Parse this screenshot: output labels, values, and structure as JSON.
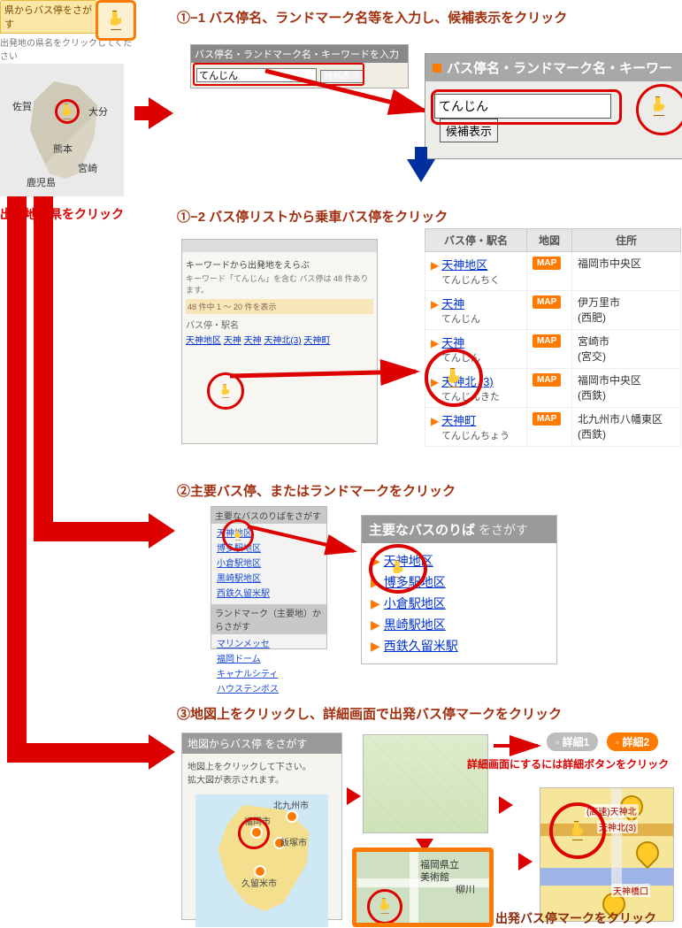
{
  "top": {
    "tab_label": "県からバス停をさがす",
    "sub_label": "出発地の県名をクリックしてください",
    "prefectures": {
      "saga": "佐賀",
      "oita": "大分",
      "kumamoto": "熊本",
      "miyazaki": "宮崎",
      "kagoshima": "鹿児島"
    },
    "caption": "出発地の県をクリック"
  },
  "step1_1": {
    "heading": "①−1 バス停名、ランドマーク名等を入力し、候補表示をクリック",
    "mini_header": "バス停名・ランドマーク名・キーワードを入力",
    "mini_placeholder": "てんじん",
    "mini_button": "候補表示",
    "big_header": "バス停名・ランドマーク名・キーワー",
    "big_input_value": "てんじん",
    "big_button": "候補表示"
  },
  "step1_2": {
    "heading": "①−2 バス停リストから乗車バス停をクリック",
    "mini_title": "キーワードから出発地をえらぶ",
    "mini_note": "キーワード「てんじん」を含む バス停は 48 件あります。",
    "mini_range": "48 件中 1 ～ 20 件を表示",
    "mini_col": "バス停・駅名",
    "mini_items": [
      "天神地区",
      "天神",
      "天神",
      "天神北(3)",
      "天神町"
    ],
    "table": {
      "columns": {
        "name": "バス停・駅名",
        "map": "地図",
        "addr": "住所"
      },
      "map_label": "MAP",
      "rows": [
        {
          "name": "天神地区",
          "yomi": "てんじんちく",
          "addr": "福岡市中央区"
        },
        {
          "name": "天神",
          "yomi": "てんじん",
          "addr": "伊万里市\n(西肥)"
        },
        {
          "name": "天神",
          "yomi": "てんじん",
          "addr": "宮崎市\n(宮交)"
        },
        {
          "name": "天神北 (3)",
          "yomi": "てんじんきた",
          "addr": "福岡市中央区\n(西鉄)"
        },
        {
          "name": "天神町",
          "yomi": "てんじんちょう",
          "addr": "北九州市八幡東区\n(西鉄)"
        }
      ]
    }
  },
  "step2": {
    "heading": "②主要バス停、またはランドマークをクリック",
    "mini_title": "主要なバスのりばをさがす",
    "mini_links": [
      "天神地区",
      "博多駅地区",
      "小倉駅地区",
      "黒崎駅地区",
      "西鉄久留米駅"
    ],
    "mini_landmark_title": "ランドマーク（主要地）からさがす",
    "mini_landmark_links": [
      "マリンメッセ",
      "福岡ドーム",
      "キャナルシティ",
      "ハウステンボス"
    ],
    "big_title_strong": "主要なバスのりば",
    "big_title_light": "をさがす",
    "big_links": [
      "天神地区",
      "博多駅地区",
      "小倉駅地区",
      "黒崎駅地区",
      "西鉄久留米駅"
    ]
  },
  "step3": {
    "heading": "③地図上をクリックし、詳細画面で出発バス停マークをクリック",
    "map_panel_title": "地図からバス停 をさがす",
    "map_panel_text": "地図上をクリックして下さい。\n拡大図が表示されます。",
    "cities": {
      "fukuoka": "福岡市",
      "kitakyushu": "北九州市",
      "iizuka": "飯塚市",
      "kurume": "久留米市"
    },
    "zoom_labels": {
      "pref": "福岡県立",
      "museum": "美術館",
      "yanagawa": "柳川"
    },
    "detail_chip1": "詳細1",
    "detail_chip2": "詳細2",
    "note1": "詳細画面にするには詳細ボタンをクリック",
    "detail_stops": [
      "(高速)天神北",
      "天神北(3)",
      "天神橋口"
    ],
    "note2": "出発バス停マークをクリック"
  }
}
